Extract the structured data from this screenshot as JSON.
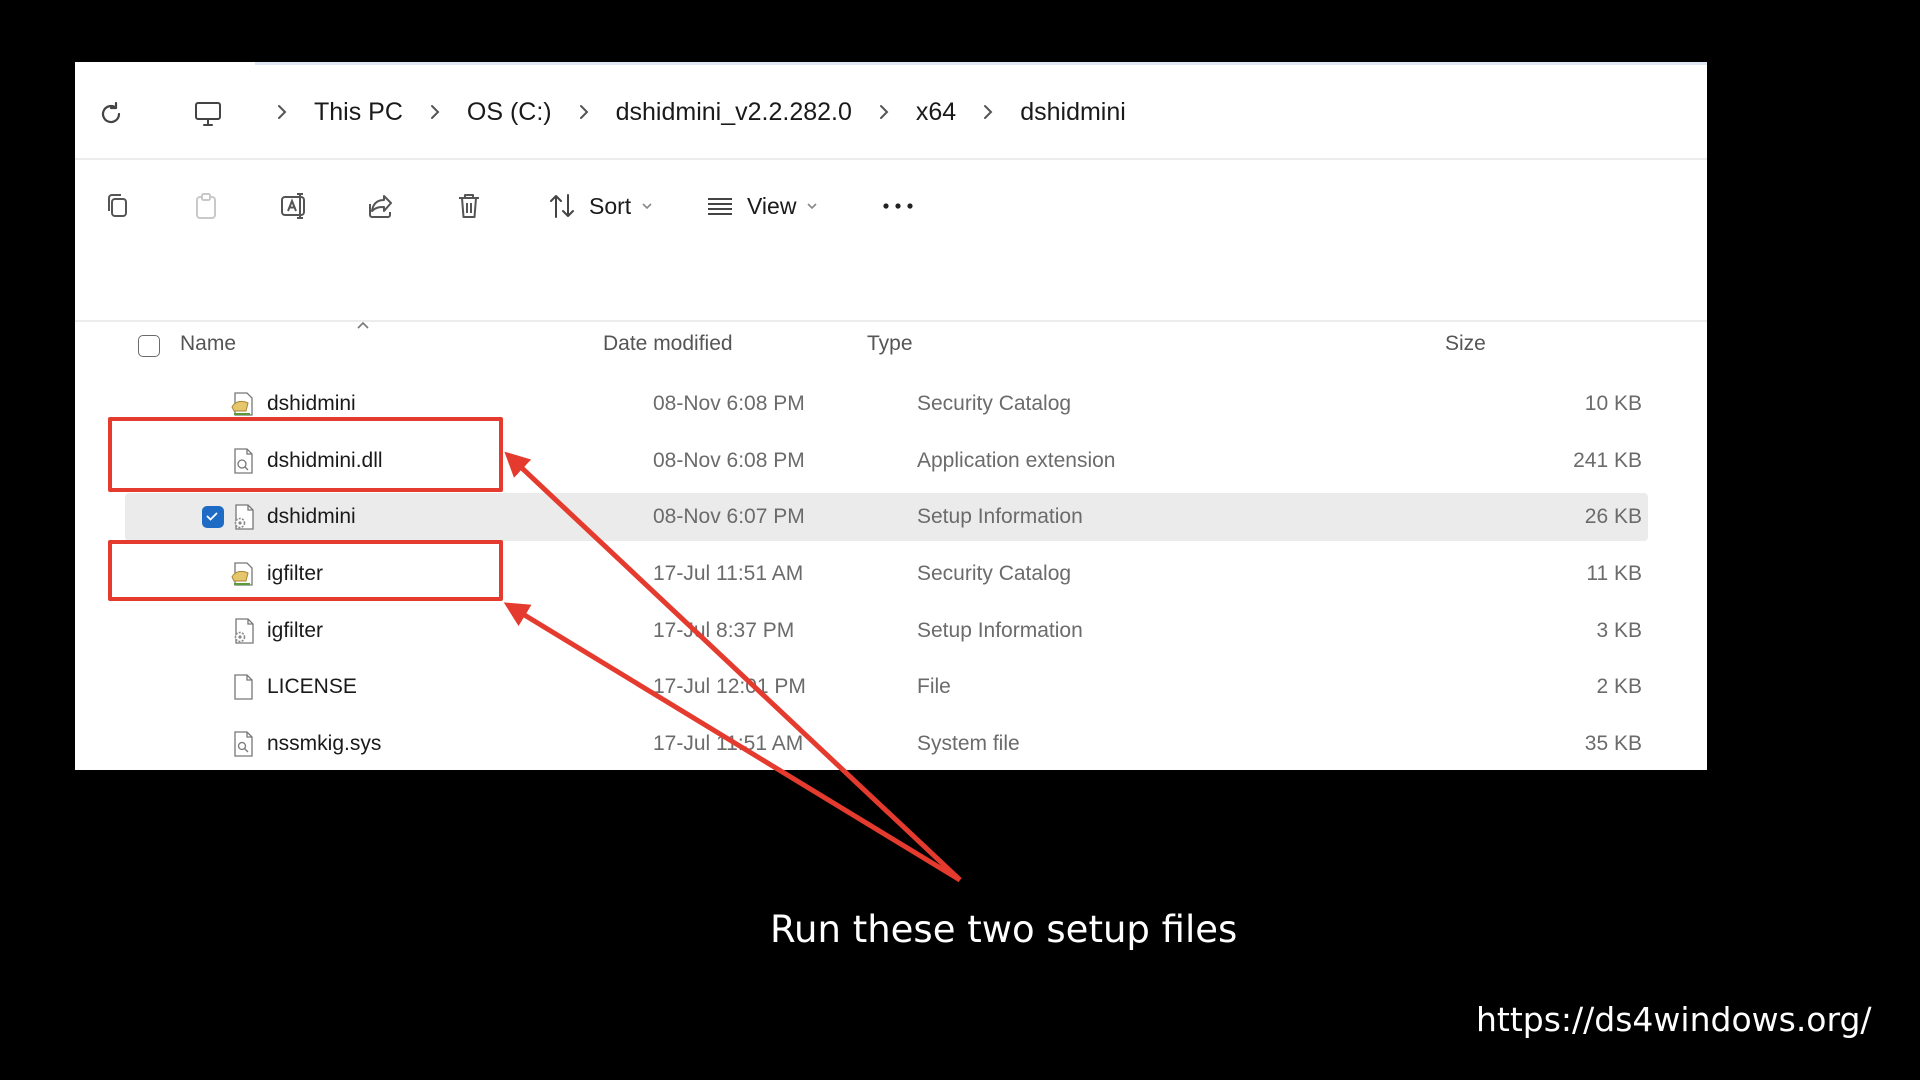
{
  "breadcrumb": [
    "This PC",
    "OS (C:)",
    "dshidmini_v2.2.282.0",
    "x64",
    "dshidmini"
  ],
  "toolbar": {
    "sort_label": "Sort",
    "view_label": "View"
  },
  "columns": {
    "name": "Name",
    "date": "Date modified",
    "type": "Type",
    "size": "Size"
  },
  "files": [
    {
      "name": "dshidmini",
      "date": "08-Nov 6:08 PM",
      "type": "Security Catalog",
      "size": "10 KB",
      "icon": "security-catalog-icon",
      "selected": false
    },
    {
      "name": "dshidmini.dll",
      "date": "08-Nov 6:08 PM",
      "type": "Application extension",
      "size": "241 KB",
      "icon": "dll-file-icon",
      "selected": false
    },
    {
      "name": "dshidmini",
      "date": "08-Nov 6:07 PM",
      "type": "Setup Information",
      "size": "26 KB",
      "icon": "setup-info-icon",
      "selected": true
    },
    {
      "name": "igfilter",
      "date": "17-Jul 11:51 AM",
      "type": "Security Catalog",
      "size": "11 KB",
      "icon": "security-catalog-icon",
      "selected": false
    },
    {
      "name": "igfilter",
      "date": "17-Jul 8:37 PM",
      "type": "Setup Information",
      "size": "3 KB",
      "icon": "setup-info-icon",
      "selected": false
    },
    {
      "name": "LICENSE",
      "date": "17-Jul 12:01 PM",
      "type": "File",
      "size": "2 KB",
      "icon": "blank-file-icon",
      "selected": false
    },
    {
      "name": "nssmkig.sys",
      "date": "17-Jul 11:51 AM",
      "type": "System file",
      "size": "35 KB",
      "icon": "system-file-icon",
      "selected": false
    }
  ],
  "annotation": {
    "caption": "Run these two setup files",
    "highlight_color": "#e53b2e"
  },
  "watermark": {
    "url": "https://ds4windows.org/"
  },
  "colors": {
    "selection": "#1e6bc6",
    "row_selected_bg": "#ebebeb"
  }
}
